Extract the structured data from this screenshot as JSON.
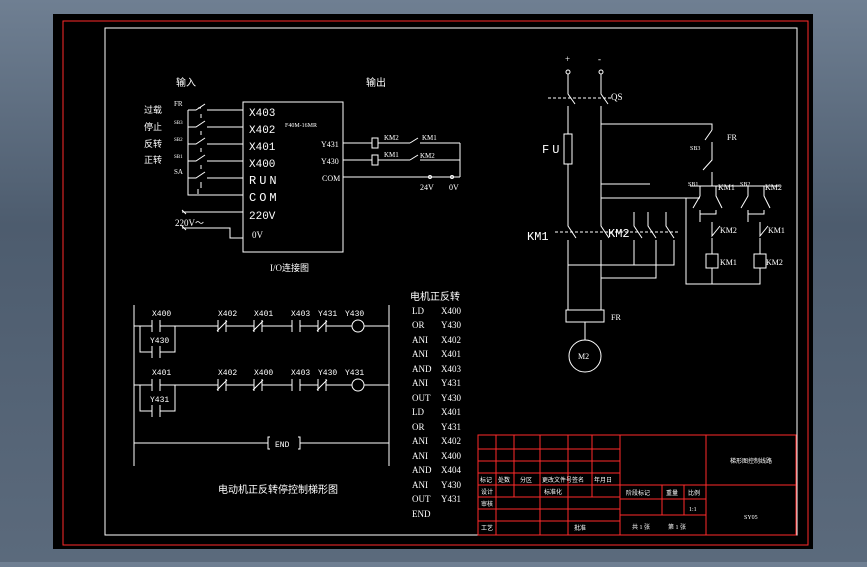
{
  "colors": {
    "background": "#000000",
    "line": "#ffffff",
    "frame": "#ff2a2a",
    "accent": "#ff2a2a"
  },
  "io": {
    "label_input": "输入",
    "label_output": "输出",
    "caption": "I/O连接图",
    "plc_model": "F40M-16MR",
    "side_labels": [
      "过载",
      "停止",
      "反转",
      "正转"
    ],
    "switch_tags": [
      "FR",
      "SB3",
      "SB2",
      "SB1",
      "SA"
    ],
    "inputs": [
      "X403",
      "X402",
      "X401",
      "X400",
      "RUN",
      "COM",
      "220V",
      "0V"
    ],
    "supply": "220V～",
    "outputs": [
      "Y431",
      "Y430",
      "COM"
    ],
    "relays": [
      "KM2",
      "KM1"
    ],
    "contacts": [
      "KM1",
      "KM2"
    ],
    "dc_pos": "24V",
    "dc_neg": "0V"
  },
  "ladder": {
    "caption": "电动机正反转停控制梯形图",
    "rung1": {
      "contacts": [
        "X400",
        "X402",
        "X401",
        "X403",
        "Y431"
      ],
      "coil": "Y430",
      "parallel": "Y430"
    },
    "rung2": {
      "contacts": [
        "X401",
        "X402",
        "X400",
        "X403",
        "Y430"
      ],
      "coil": "Y431",
      "parallel": "Y431"
    },
    "end": "END"
  },
  "program": {
    "title": "电机正反转",
    "lines": [
      [
        "LD",
        "X400"
      ],
      [
        "OR",
        "Y430"
      ],
      [
        "ANI",
        "X402"
      ],
      [
        "ANI",
        "X401"
      ],
      [
        "AND",
        "X403"
      ],
      [
        "ANI",
        "Y431"
      ],
      [
        "OUT",
        "Y430"
      ],
      [
        "LD",
        "X401"
      ],
      [
        "OR",
        "Y431"
      ],
      [
        "ANI",
        "X402"
      ],
      [
        "ANI",
        "X400"
      ],
      [
        "AND",
        "X404"
      ],
      [
        "ANI",
        "Y430"
      ],
      [
        "OUT",
        "Y431"
      ],
      [
        "END",
        ""
      ]
    ]
  },
  "power": {
    "plus": "+",
    "minus": "-",
    "qs": "QS",
    "fu": "FU",
    "fr": "FR",
    "km1": "KM1",
    "km2": "KM2",
    "motor": "M2",
    "ctrl_fr": "FR",
    "ctrl_sb3": "SB3",
    "ctrl_sb1": "SB1",
    "ctrl_sb2": "SB2",
    "ctrl_km1": "KM1",
    "ctrl_km2": "KM2",
    "ctrl_interlock1": "KM2",
    "ctrl_interlock2": "KM1",
    "coil1": "KM1",
    "coil2": "KM2"
  },
  "title_block": {
    "row_labels": [
      "标记",
      "处数",
      "分区",
      "更改文件号",
      "签名",
      "年月日"
    ],
    "designer": "设计",
    "standard": "标准化",
    "review": "审核",
    "process": "工艺",
    "approve": "批准",
    "stage": "阶段标记",
    "weight": "重量",
    "scale": "比例",
    "ratio": "1:1",
    "sheets": "共 1 张",
    "sheet": "第 1 张",
    "drawing_name": "梯形图控制线路",
    "code": "SY05"
  }
}
